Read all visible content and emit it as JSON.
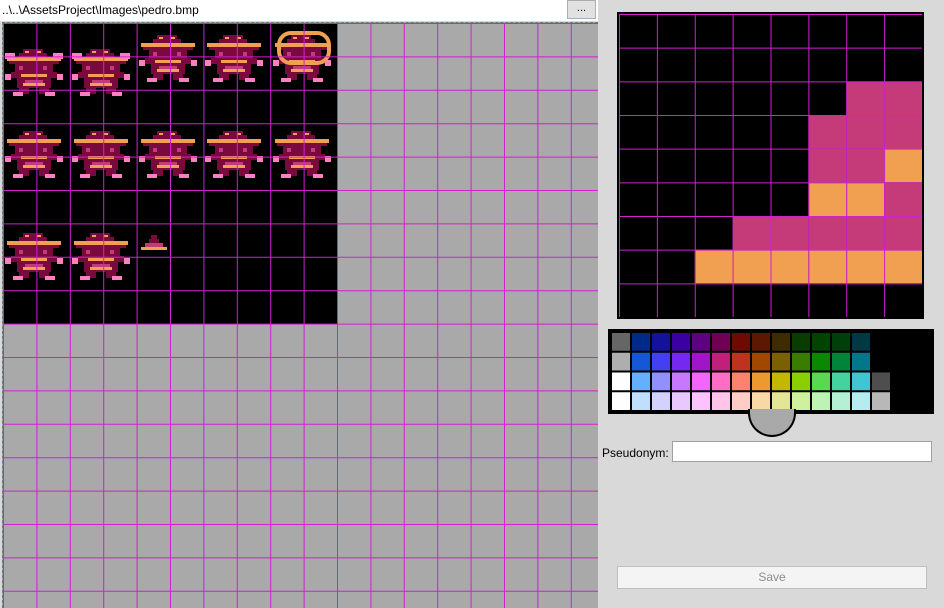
{
  "header": {
    "file_path": "..\\..\\AssetsProject\\Images\\pedro.bmp",
    "browse_label": "..."
  },
  "form": {
    "pseudonym_label": "Pseudonym:",
    "pseudonym_value": "",
    "save_label": "Save"
  },
  "colors": {
    "window_bg": "#d9d9d9",
    "canvas_bg": "#a9a9a9",
    "grid_line": "#d020d0",
    "black": "#000000",
    "dark_maroon": "#7a0a3e",
    "magenta_pink": "#c53a79",
    "light_pink": "#ff80c0",
    "orange": "#f0a050"
  },
  "zoom_view": {
    "cells": [
      "........",
      "........",
      "......PP",
      ".....PPP",
      ".....PPO",
      ".....OOP",
      "...PPPPP",
      "..OOOOOO",
      "........"
    ]
  },
  "palette": {
    "rows": [
      [
        "#666666",
        "#002a88",
        "#14129c",
        "#3b00a0",
        "#5d0082",
        "#720052",
        "#6e0a00",
        "#5c1800",
        "#3c2c00",
        "#0a3c00",
        "#004400",
        "#003e0a",
        "#003844",
        "#000000",
        "#000000",
        "#000000"
      ],
      [
        "#aeaeae",
        "#1558d6",
        "#4440f0",
        "#7528f0",
        "#a214c8",
        "#c0207a",
        "#be3220",
        "#a04800",
        "#7a6000",
        "#3a7c00",
        "#0a8800",
        "#00843a",
        "#007888",
        "#000000",
        "#000000",
        "#000000"
      ],
      [
        "#fefefe",
        "#64b0fe",
        "#9190fe",
        "#c878fe",
        "#f366fe",
        "#fe6ec4",
        "#fe8270",
        "#ec9a30",
        "#c2b800",
        "#8ad000",
        "#5ad852",
        "#44d29e",
        "#40c6d0",
        "#4e4e4e",
        "#000000",
        "#000000"
      ],
      [
        "#fefefe",
        "#c0dffe",
        "#d3d2fe",
        "#e8c8fe",
        "#fbc2fe",
        "#fec4ea",
        "#fecdc6",
        "#f7d8a6",
        "#e4e596",
        "#cff09c",
        "#bdf3b4",
        "#b5f0d4",
        "#b6ecf0",
        "#b8b8b8",
        "#000000",
        "#000000"
      ]
    ]
  }
}
